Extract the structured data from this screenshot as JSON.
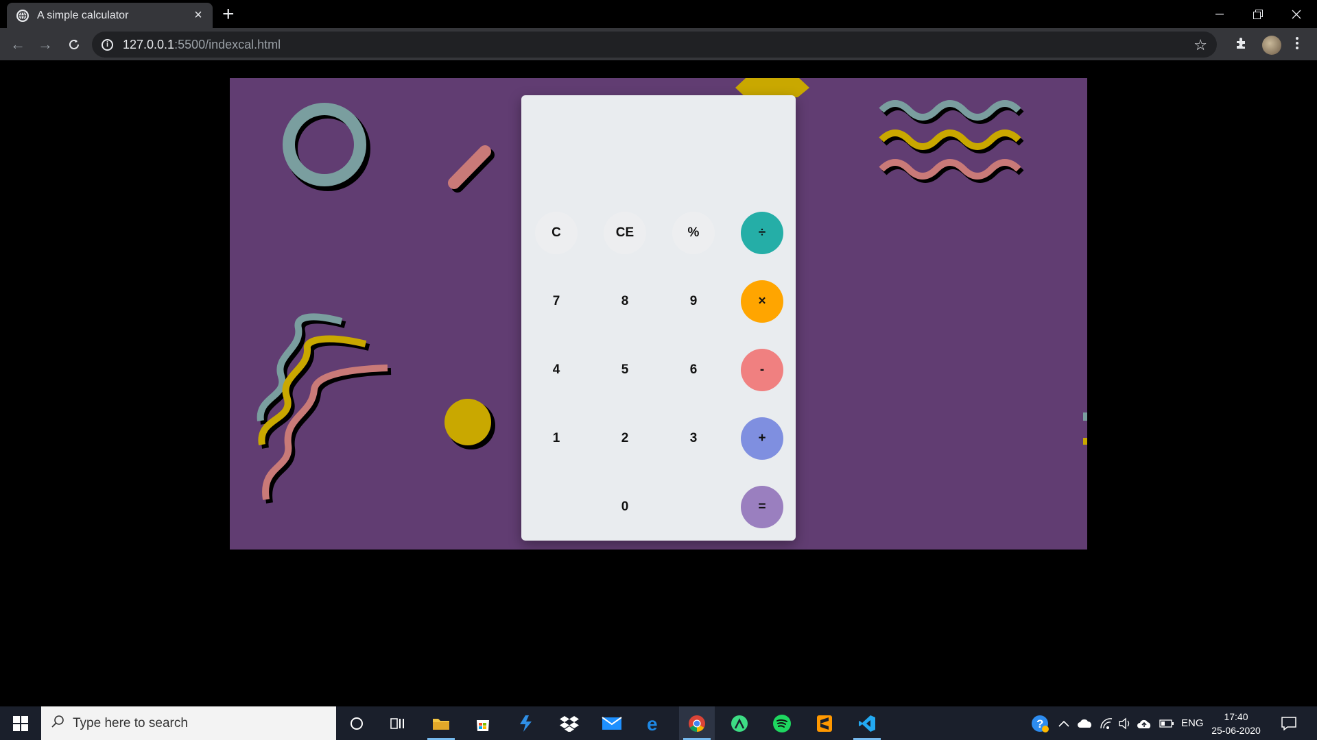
{
  "browser": {
    "tab_title": "A simple calculator",
    "url_host": "127.0.0.1",
    "url_path": ":5500/indexcal.html"
  },
  "calculator": {
    "display": "",
    "rows": [
      [
        {
          "label": "C",
          "name": "clear-button",
          "style": "light"
        },
        {
          "label": "CE",
          "name": "clear-entry-button",
          "style": "light"
        },
        {
          "label": "%",
          "name": "percent-button",
          "style": "light"
        },
        {
          "label": "÷",
          "name": "divide-button",
          "style": "op",
          "color": "#25aea7"
        }
      ],
      [
        {
          "label": "7",
          "name": "digit-7-button",
          "style": "plain"
        },
        {
          "label": "8",
          "name": "digit-8-button",
          "style": "plain"
        },
        {
          "label": "9",
          "name": "digit-9-button",
          "style": "plain"
        },
        {
          "label": "×",
          "name": "multiply-button",
          "style": "op",
          "color": "#ffa500"
        }
      ],
      [
        {
          "label": "4",
          "name": "digit-4-button",
          "style": "plain"
        },
        {
          "label": "5",
          "name": "digit-5-button",
          "style": "plain"
        },
        {
          "label": "6",
          "name": "digit-6-button",
          "style": "plain"
        },
        {
          "label": "-",
          "name": "subtract-button",
          "style": "op",
          "color": "#f08080"
        }
      ],
      [
        {
          "label": "1",
          "name": "digit-1-button",
          "style": "plain"
        },
        {
          "label": "2",
          "name": "digit-2-button",
          "style": "plain"
        },
        {
          "label": "3",
          "name": "digit-3-button",
          "style": "plain"
        },
        {
          "label": "+",
          "name": "add-button",
          "style": "op",
          "color": "#7f8fe0"
        }
      ],
      [
        null,
        {
          "label": "0",
          "name": "digit-0-button",
          "style": "plain"
        },
        null,
        {
          "label": "=",
          "name": "equals-button",
          "style": "op",
          "color": "#9a7fbf"
        }
      ]
    ]
  },
  "colors": {
    "stage": "#613d72",
    "teal": "#7a9e9f",
    "mustard": "#c9a800",
    "salmon": "#c97a78"
  },
  "taskbar": {
    "search_placeholder": "Type here to search",
    "language": "ENG",
    "time": "17:40",
    "date": "25-06-2020"
  }
}
